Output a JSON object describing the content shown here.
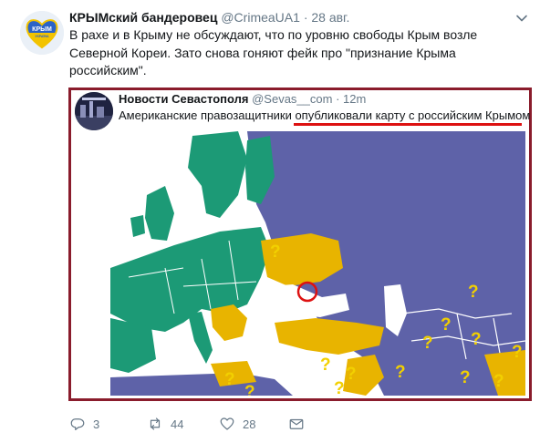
{
  "author": {
    "name": "КРЫМский бандеровец",
    "handle": "@CrimeaUA1",
    "separator": "·",
    "date": "28 авг."
  },
  "tweet_text": "В рахе и в Крыму не обсуждают, что по уровню свободы Крым возле Северной Кореи. Зато снова гоняют фейк про \"признание Крыма российским\".",
  "quoted": {
    "name": "Новости Севастополя",
    "handle": "@Sevas__com",
    "separator": "·",
    "time": "12m",
    "text": "Американские правозащитники опубликовали карту с российским Крымом"
  },
  "avatar": {
    "logo_top": "КРЫМ",
    "logo_bottom": "УКРАЇНА"
  },
  "map": {
    "question_mark": "?",
    "colors": {
      "ocean": "#ffffff",
      "green": "#1c9a76",
      "blue": "#5e62a8",
      "yellow": "#e8b400",
      "border": "#ffffff",
      "highlight": "#d11"
    }
  },
  "actions": {
    "reply_count": "3",
    "retweet_count": "44",
    "like_count": "28"
  }
}
